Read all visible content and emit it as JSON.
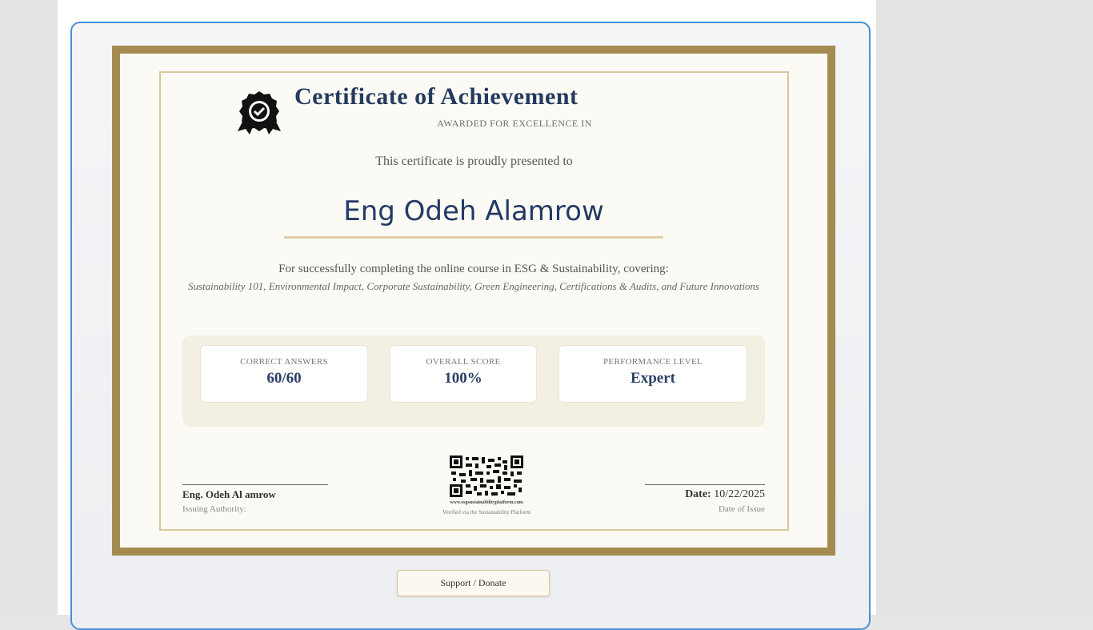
{
  "certificate": {
    "title": "Certificate of Achievement",
    "subtitle": "AWARDED FOR EXCELLENCE IN",
    "presented_text": "This certificate is proudly presented to",
    "recipient": "Eng Odeh Alamrow",
    "course_text": "For successfully completing the online course in ESG & Sustainability, covering:",
    "course_topics": "Sustainability 101, Environmental Impact, Corporate Sustainability, Green Engineering, Certifications & Audits, and Future Innovations",
    "stats": [
      {
        "label": "CORRECT ANSWERS",
        "value": "60/60"
      },
      {
        "label": "OVERALL SCORE",
        "value": "100%"
      },
      {
        "label": "PERFORMANCE LEVEL",
        "value": "Expert"
      }
    ],
    "issuer_name": "Eng. Odeh Al amrow",
    "issuer_role": "Issuing Authority:",
    "date_label": "Date:",
    "date_value": "10/22/2025",
    "date_caption": "Date of Issue",
    "verify_url": "www.esgsustainabilityplatform.com",
    "verify_note": "Verified via the Sustainability Platform"
  },
  "actions": {
    "support_label": "Support / Donate"
  },
  "icons": {
    "badge": "award-badge-icon",
    "qr": "qr-code"
  },
  "colors": {
    "frame": "#a58b52",
    "title": "#243a5e",
    "panel_border": "#4a8fd6"
  }
}
